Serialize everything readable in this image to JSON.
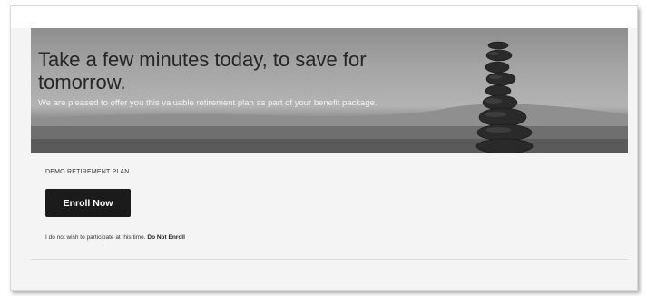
{
  "hero": {
    "title": "Take a few minutes today, to save for tomorrow.",
    "subtitle": "We are pleased to offer you this valuable retirement plan as part of your benefit package.",
    "image": "stacked-stones-beach-image"
  },
  "plan": {
    "name": "DEMO RETIREMENT PLAN",
    "enroll_label": "Enroll Now",
    "decline_text": "I do not wish to participate at this time.",
    "decline_link": "Do Not Enroll"
  },
  "colors": {
    "button_bg": "#1b1b1b",
    "page_bg": "#f4f4f4"
  }
}
